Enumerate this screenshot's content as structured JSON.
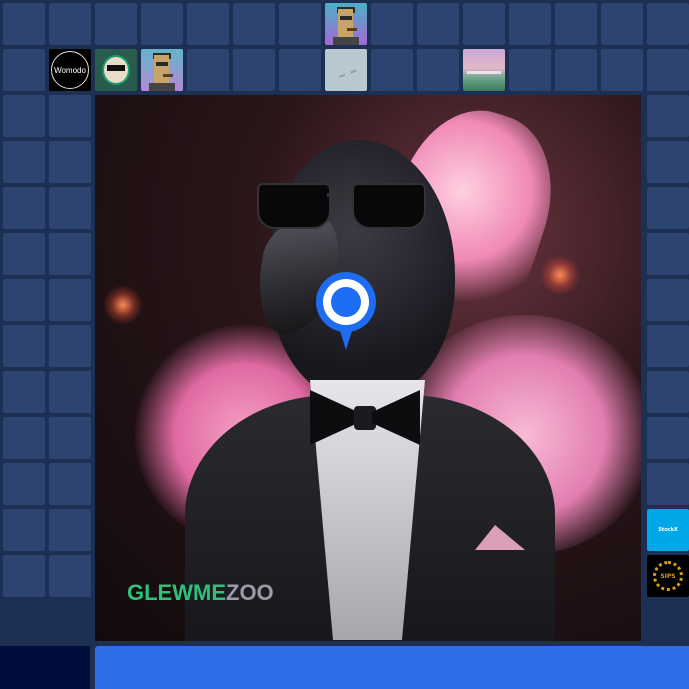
{
  "colors": {
    "background": "#1d2f52",
    "cell": "#2d4470",
    "pin": "#1e6cf2",
    "bottom_bar": "#2e6ee8",
    "bottom_left": "#000d3d",
    "brand_green": "#2fc07a"
  },
  "grid": {
    "columns": 15,
    "rows": 14,
    "occupied_cells": [
      {
        "row": 0,
        "col": 7,
        "kind": "punk-purple"
      },
      {
        "row": 1,
        "col": 1,
        "kind": "womodo",
        "label": "Womodo"
      },
      {
        "row": 1,
        "col": 2,
        "kind": "robot"
      },
      {
        "row": 1,
        "col": 3,
        "kind": "punk-teal"
      },
      {
        "row": 1,
        "col": 7,
        "kind": "ghost"
      },
      {
        "row": 1,
        "col": 10,
        "kind": "landscape"
      },
      {
        "row": 11,
        "col": 14,
        "kind": "stockx",
        "label": "StockX"
      },
      {
        "row": 12,
        "col": 14,
        "kind": "sips",
        "label": "SIPS"
      }
    ]
  },
  "feature": {
    "brand_prefix": "GLEWME",
    "brand_suffix": "ZOO",
    "pin_icon": "location-pin-icon"
  }
}
